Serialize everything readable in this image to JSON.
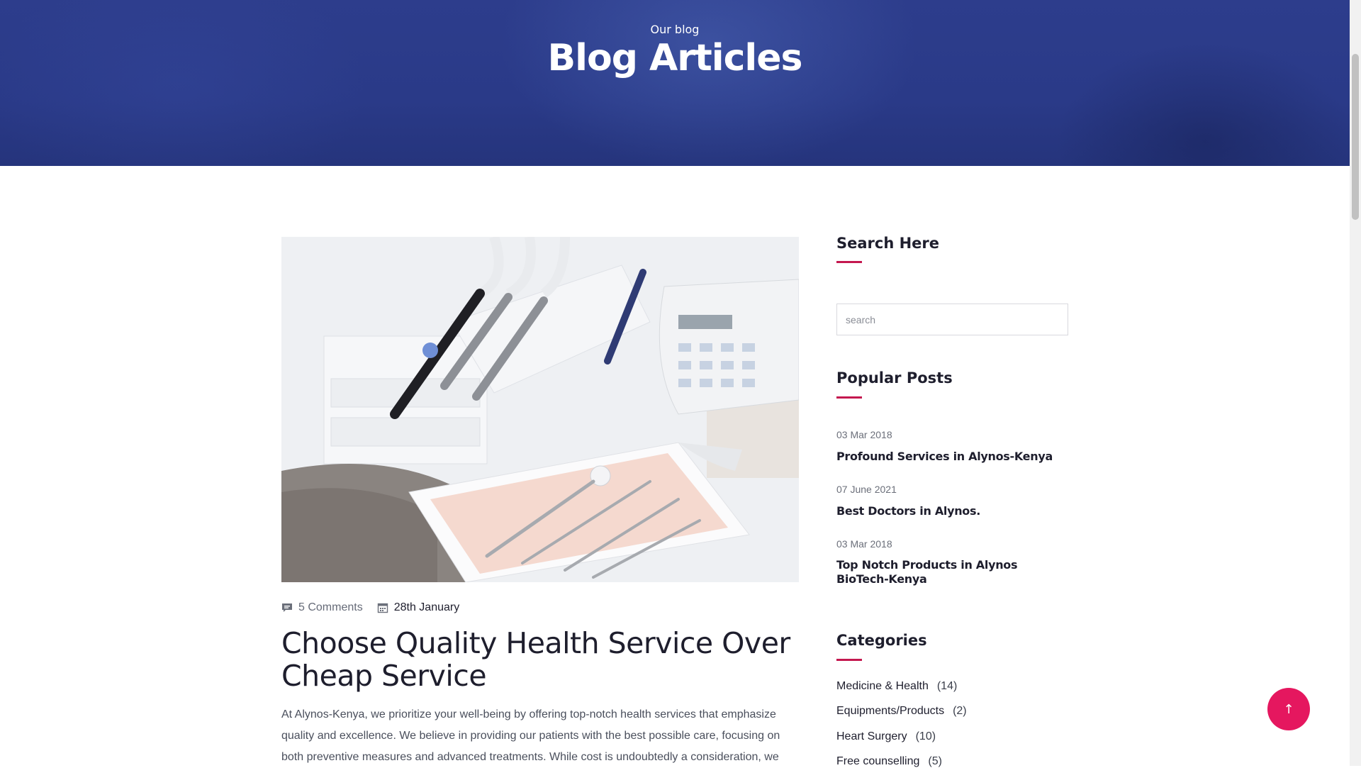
{
  "hero": {
    "subtitle": "Our blog",
    "title": "Blog Articles"
  },
  "article": {
    "image_subject": "dental chair instruments and tray",
    "comments": "5 Comments",
    "date": "28th January",
    "title": "Choose Quality Health Service Over Cheap Service",
    "excerpt": "At Alynos-Kenya, we prioritize your well-being by offering top-notch health services that emphasize quality and excellence. We believe in providing our patients with the best possible care, focusing on both preventive measures and advanced treatments. While cost is undoubtedly a consideration, we"
  },
  "sidebar": {
    "search": {
      "title": "Search Here",
      "placeholder": "search"
    },
    "popular": {
      "title": "Popular Posts",
      "posts": [
        {
          "date": "03 Mar 2018",
          "title": "Profound Services in Alynos-Kenya"
        },
        {
          "date": "07 June 2021",
          "title": "Best Doctors in Alynos."
        },
        {
          "date": "03 Mar 2018",
          "title": "Top Notch Products in Alynos BioTech-Kenya"
        }
      ]
    },
    "categories": {
      "title": "Categories",
      "items": [
        {
          "label": "Medicine & Health",
          "count": "(14)"
        },
        {
          "label": "Equipments/Products",
          "count": "(2)"
        },
        {
          "label": "Heart Surgery",
          "count": "(10)"
        },
        {
          "label": "Free counselling",
          "count": "(5)"
        }
      ]
    }
  },
  "back_to_top": {
    "icon": "arrow-up-icon",
    "glyph": "↑"
  },
  "colors": {
    "hero_bg": "#2d3d8c",
    "accent": "#c4184f",
    "back_to_top": "#e5175f",
    "text_dark": "#1e1e2d"
  }
}
